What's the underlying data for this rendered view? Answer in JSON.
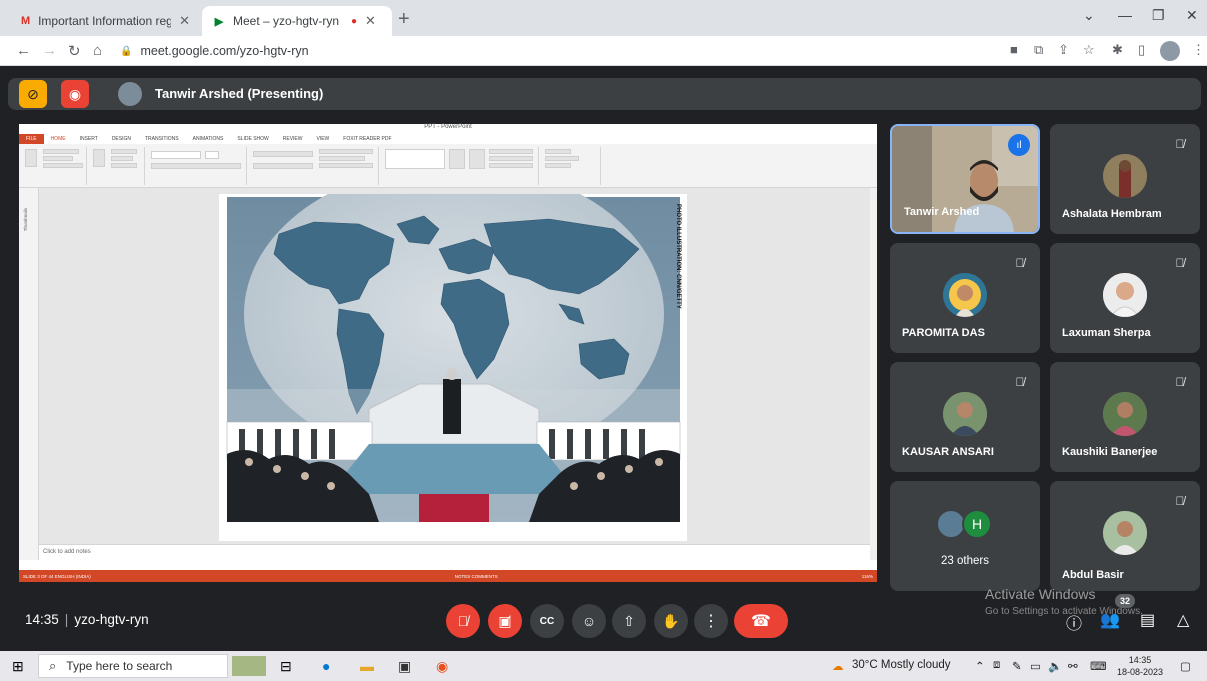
{
  "browser": {
    "tabs": [
      {
        "title": "Important Information regarding",
        "icon": "gmail-icon"
      },
      {
        "title": "Meet – yzo-hgtv-ryn",
        "icon": "meet-icon",
        "recording_dot": "●"
      }
    ],
    "url": "meet.google.com/yzo-hgtv-ryn"
  },
  "meet": {
    "presenter_label": "Tanwir Arshed (Presenting)",
    "time": "14:35",
    "meeting_code": "yzo-hgtv-ryn",
    "participant_count": "32",
    "participants": [
      {
        "name": "Tanwir Arshed",
        "speaking": true
      },
      {
        "name": "Ashalata Hembram"
      },
      {
        "name": "PAROMITA DAS"
      },
      {
        "name": "Laxuman Sherpa"
      },
      {
        "name": "KAUSAR ANSARI"
      },
      {
        "name": "Kaushiki Banerjee"
      },
      {
        "name": "23 others",
        "initial": "H"
      },
      {
        "name": "Abdul Basir"
      }
    ],
    "activate_title": "Activate Windows",
    "activate_sub": "Go to Settings to activate Windows."
  },
  "ppt": {
    "window_title": "PPT - PowerPoint",
    "ribbon_tabs": [
      "FILE",
      "HOME",
      "INSERT",
      "DESIGN",
      "TRANSITIONS",
      "ANIMATIONS",
      "SLIDE SHOW",
      "REVIEW",
      "VIEW",
      "FOXIT READER PDF"
    ],
    "notes_placeholder": "Click to add notes",
    "status_left": "SLIDE 3 OF 44   ENGLISH (INDIA)",
    "status_right": "NOTES   COMMENTS",
    "zoom": "116%",
    "thumbnails_label": "Thumbnails",
    "slide_credit": "PHOTO ILLUSTRATION: CNN/GETTY"
  },
  "taskbar": {
    "search_placeholder": "Type here to search",
    "weather": "30°C  Mostly cloudy",
    "time": "14:35",
    "date": "18-08-2023"
  }
}
